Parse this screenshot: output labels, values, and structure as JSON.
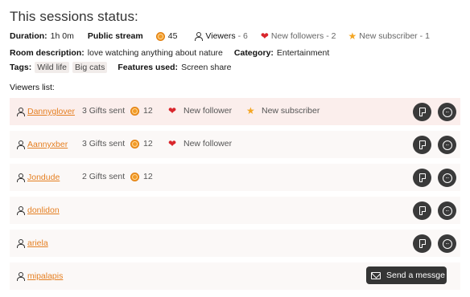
{
  "title": "This sessions status:",
  "summary": {
    "duration_label": "Duration:",
    "duration_value": "1h 0m",
    "stream_type": "Public stream",
    "coins": "45",
    "viewers_label": "Viewers",
    "viewers_value": "- 6",
    "new_followers_label": "New followers",
    "new_followers_value": "- 2",
    "new_subscriber_label": "New subscriber",
    "new_subscriber_value": "- 1"
  },
  "room": {
    "description_label": "Room description:",
    "description_value": "love watching anything about nature",
    "category_label": "Category:",
    "category_value": "Entertainment"
  },
  "tags": {
    "label": "Tags:",
    "items": [
      "Wild life",
      "Big cats"
    ],
    "features_label": "Features used:",
    "features_value": "Screen share"
  },
  "viewers_list_label": "Viewers list:",
  "viewers": [
    {
      "name": "Dannyglover",
      "gifts": "3 Gifts sent",
      "coins": "12",
      "follower": "New follower",
      "subscriber": "New subscriber"
    },
    {
      "name": "Aannyxber",
      "gifts": "3 Gifts sent",
      "coins": "12",
      "follower": "New follower"
    },
    {
      "name": "Jondude",
      "gifts": "2 Gifts sent",
      "coins": "12"
    },
    {
      "name": "donlidon"
    },
    {
      "name": "ariela"
    },
    {
      "name": "mipalapis"
    }
  ],
  "send_message_label": "Send a messge",
  "colors": {
    "link": "#e57f21",
    "coin": "#f29c27",
    "heart": "#d9262c",
    "star": "#f4a623",
    "dark_button": "#3a3a3a",
    "highlight_row": "#fbeeec",
    "row_bg": "#fbf8f7"
  }
}
